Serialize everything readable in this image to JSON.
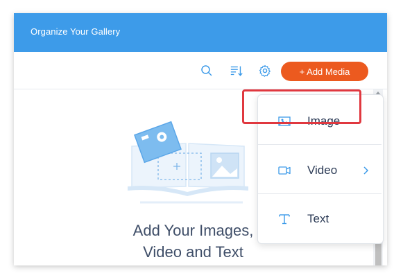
{
  "header": {
    "title": "Organize Your Gallery"
  },
  "toolbar": {
    "icons": [
      "search-icon",
      "sort-icon",
      "gear-icon"
    ],
    "add_media_label": "+ Add Media"
  },
  "empty_state": {
    "title_line1": "Add Your Images,",
    "title_line2": "Video and Text"
  },
  "dropdown": {
    "items": [
      {
        "label": "Image",
        "icon": "image-icon",
        "highlighted": true
      },
      {
        "label": "Video",
        "icon": "video-icon",
        "has_submenu": true
      },
      {
        "label": "Text",
        "icon": "text-icon"
      }
    ]
  },
  "colors": {
    "header_bg": "#3d9be9",
    "accent_button": "#ec5a1f",
    "highlight_border": "#e0383f",
    "text_dark": "#2b3a55",
    "icon_blue": "#3d9be9"
  }
}
